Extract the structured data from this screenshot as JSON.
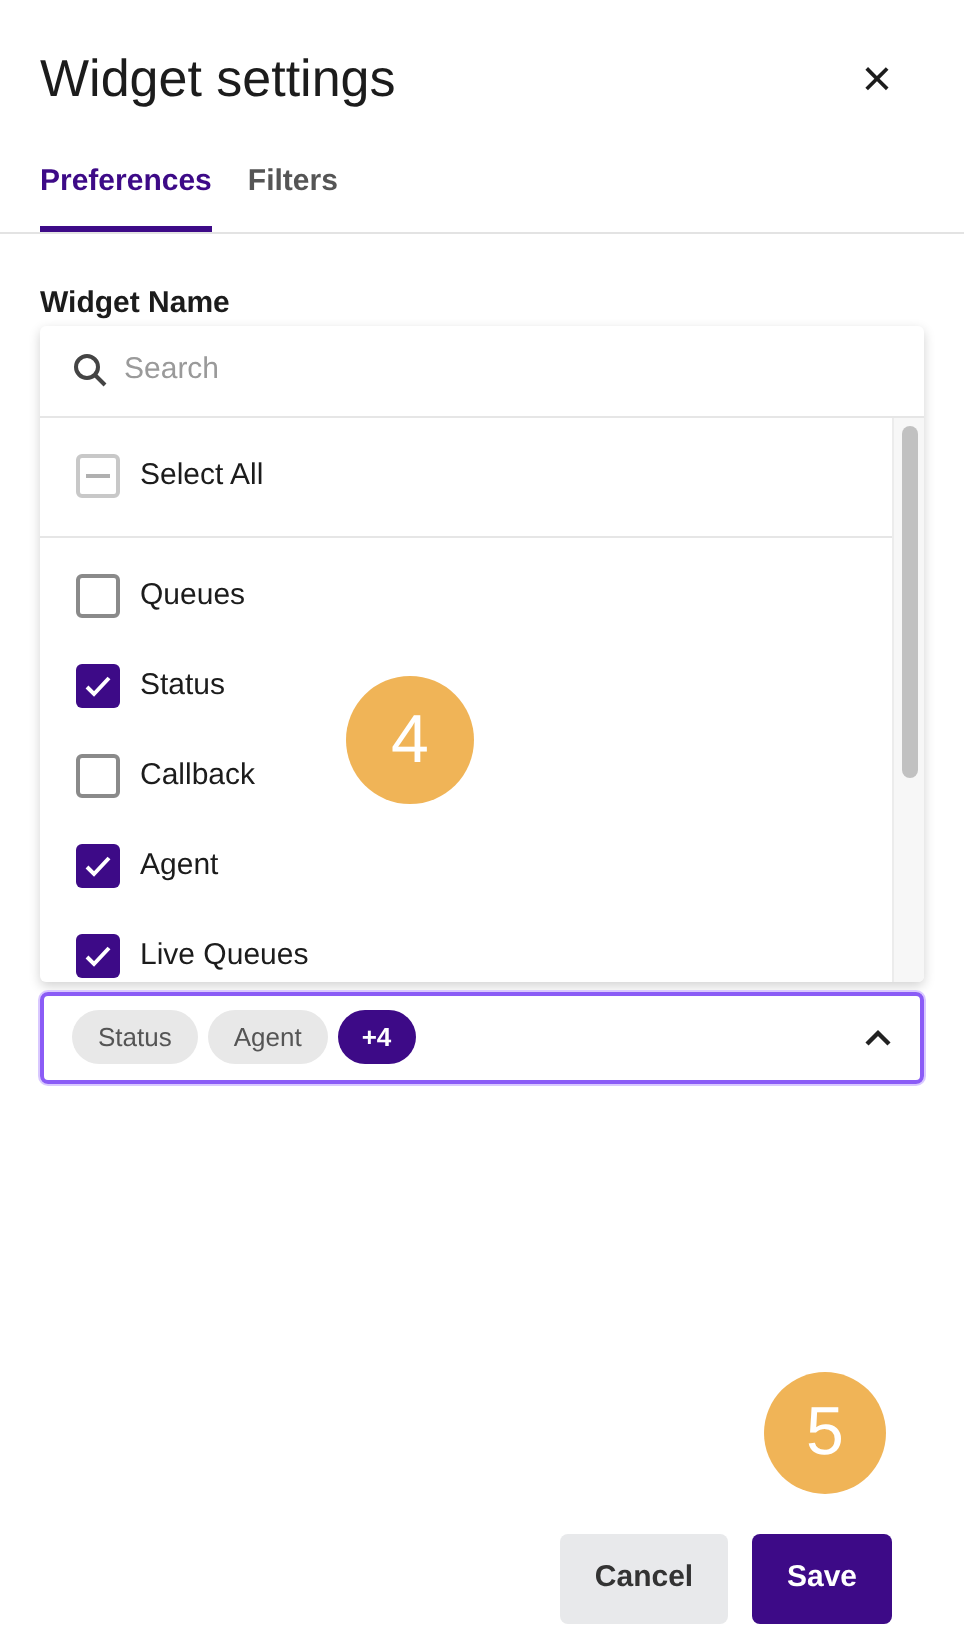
{
  "dialog": {
    "title": "Widget settings",
    "close": "×"
  },
  "tabs": [
    {
      "label": "Preferences",
      "selected": true
    },
    {
      "label": "Filters",
      "selected": false
    }
  ],
  "field": {
    "label": "Widget Name",
    "search": {
      "placeholder": "Search"
    },
    "select_all": {
      "label": "Select All",
      "indeterminate": true
    },
    "options": [
      {
        "label": "Queues",
        "checked": false
      },
      {
        "label": "Status",
        "checked": true
      },
      {
        "label": "Callback",
        "checked": false
      },
      {
        "label": "Agent",
        "checked": true
      },
      {
        "label": "Live Queues",
        "checked": true
      }
    ],
    "chips": [
      {
        "label": "Status",
        "kind": "chip"
      },
      {
        "label": "Agent",
        "kind": "chip"
      },
      {
        "label": "+4",
        "kind": "count"
      }
    ],
    "expanded": true
  },
  "markers": [
    {
      "label": "4"
    },
    {
      "label": "5"
    }
  ],
  "buttons": [
    {
      "label": "Cancel",
      "kind": "secondary"
    },
    {
      "label": "Save",
      "kind": "primary"
    }
  ]
}
